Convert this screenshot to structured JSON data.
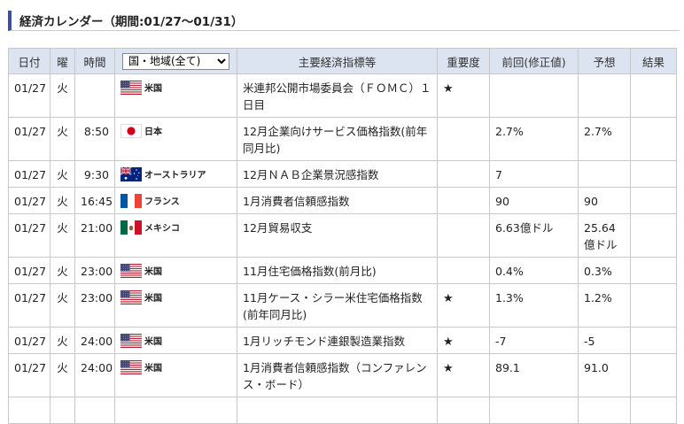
{
  "page": {
    "title": "経済カレンダー（期間:01/27〜01/31）"
  },
  "table": {
    "headers": {
      "date": "日付",
      "dow": "曜",
      "time": "時間",
      "country_select": {
        "selected": "国・地域(全て)"
      },
      "indicator": "主要経済指標等",
      "importance": "重要度",
      "previous": "前回(修正値)",
      "forecast": "予想",
      "result": "結果"
    },
    "rows": [
      {
        "date": "01/27",
        "dow": "火",
        "time": "",
        "flag": "us-flag-icon",
        "country": "米国",
        "indicator": "米連邦公開市場委員会（ＦＯＭＣ）１日目",
        "importance": "★",
        "previous": "",
        "forecast": "",
        "result": ""
      },
      {
        "date": "01/27",
        "dow": "火",
        "time": "8:50",
        "flag": "jp-flag-icon",
        "country": "日本",
        "indicator": "12月企業向けサービス価格指数(前年同月比)",
        "importance": "",
        "previous": "2.7%",
        "forecast": "2.7%",
        "result": ""
      },
      {
        "date": "01/27",
        "dow": "火",
        "time": "9:30",
        "flag": "au-flag-icon",
        "country": "オーストラリア",
        "indicator": "12月ＮＡＢ企業景況感指数",
        "importance": "",
        "previous": "7",
        "forecast": "",
        "result": ""
      },
      {
        "date": "01/27",
        "dow": "火",
        "time": "16:45",
        "flag": "fr-flag-icon",
        "country": "フランス",
        "indicator": "1月消費者信頼感指数",
        "importance": "",
        "previous": "90",
        "forecast": "90",
        "result": ""
      },
      {
        "date": "01/27",
        "dow": "火",
        "time": "21:00",
        "flag": "mx-flag-icon",
        "country": "メキシコ",
        "indicator": "12月貿易収支",
        "importance": "",
        "previous": "6.63億ドル",
        "forecast": "25.64億ドル",
        "result": ""
      },
      {
        "date": "01/27",
        "dow": "火",
        "time": "23:00",
        "flag": "us-flag-icon",
        "country": "米国",
        "indicator": "11月住宅価格指数(前月比)",
        "importance": "",
        "previous": "0.4%",
        "forecast": "0.3%",
        "result": ""
      },
      {
        "date": "01/27",
        "dow": "火",
        "time": "23:00",
        "flag": "us-flag-icon",
        "country": "米国",
        "indicator": "11月ケース・シラー米住宅価格指数(前年同月比)",
        "importance": "★",
        "previous": "1.3%",
        "forecast": "1.2%",
        "result": ""
      },
      {
        "date": "01/27",
        "dow": "火",
        "time": "24:00",
        "flag": "us-flag-icon",
        "country": "米国",
        "indicator": "1月リッチモンド連銀製造業指数",
        "importance": "★",
        "previous": "-7",
        "forecast": "-5",
        "result": ""
      },
      {
        "date": "01/27",
        "dow": "火",
        "time": "24:00",
        "flag": "us-flag-icon",
        "country": "米国",
        "indicator": "1月消費者信頼感指数（コンファレンス・ボード）",
        "importance": "★",
        "previous": "89.1",
        "forecast": "91.0",
        "result": ""
      }
    ]
  }
}
